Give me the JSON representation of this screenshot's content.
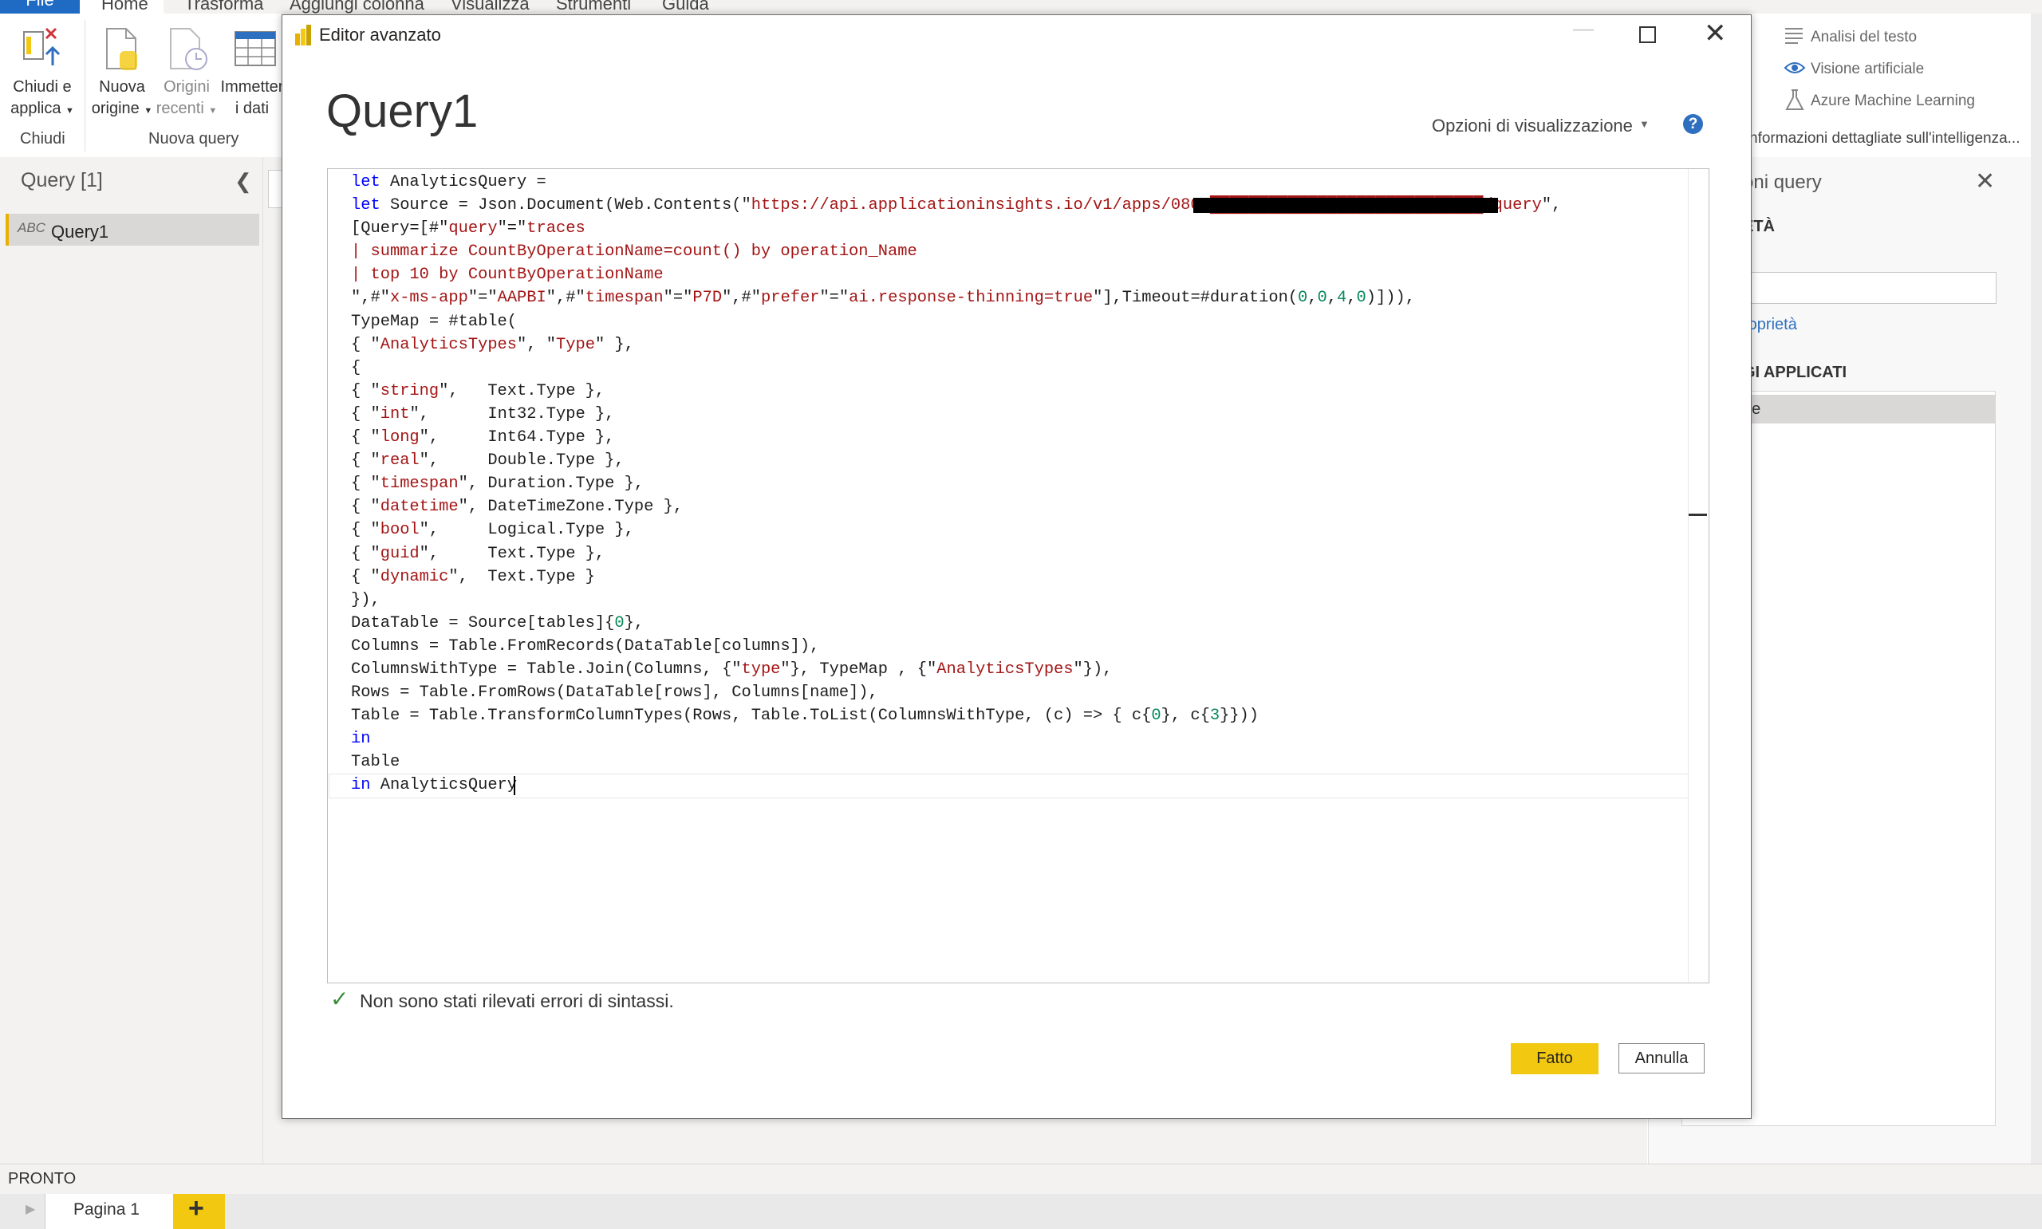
{
  "menu": {
    "tabs": [
      "File",
      "Home",
      "Trasforma",
      "Aggiungi colonna",
      "Visualizza",
      "Strumenti",
      "Guida"
    ]
  },
  "ribbon": {
    "close_apply": [
      "Chiudi e",
      "applica"
    ],
    "new_source": [
      "Nuova",
      "origine"
    ],
    "recent_sources": [
      "Origini",
      "recenti"
    ],
    "enter_data": [
      "Immetter",
      "i dati"
    ],
    "group_close": "Chiudi",
    "group_new_query": "Nuova query",
    "ai": {
      "text_analytics": "Analisi del testo",
      "vision": "Visione artificiale",
      "azure_ml": "Azure Machine Learning",
      "insights": "nformazioni dettagliate sull'intelligenza..."
    }
  },
  "left_pane": {
    "title": "Query [1]",
    "item": "Query1",
    "item_icon": "ABC"
  },
  "right_pane": {
    "title": "oni query",
    "properties": "ETÀ",
    "all_properties": "roprietà",
    "applied_steps": "GI APPLICATI",
    "step": "ne"
  },
  "status": "PRONTO",
  "pages": {
    "tab": "Pagina 1",
    "add": "+"
  },
  "dialog": {
    "title": "Editor avanzato",
    "query_name": "Query1",
    "view_options": "Opzioni di visualizzazione",
    "syntax_message": "Non sono stati rilevati errori di sintassi.",
    "done": "Fatto",
    "cancel": "Annulla",
    "code": [
      "let AnalyticsQuery =",
      "let Source = Json.Document(Web.Contents(\"https://api.applicationinsights.io/v1/apps/080a████████████████████████████/query\",",
      "[Query=[#\"query\"=\"traces",
      "| summarize CountByOperationName=count() by operation_Name",
      "| top 10 by CountByOperationName",
      "\",#\"x-ms-app\"=\"AAPBI\",#\"timespan\"=\"P7D\",#\"prefer\"=\"ai.response-thinning=true\"],Timeout=#duration(0,0,4,0)])),",
      "TypeMap = #table(",
      "{ \"AnalyticsTypes\", \"Type\" },",
      "{",
      "{ \"string\",   Text.Type },",
      "{ \"int\",      Int32.Type },",
      "{ \"long\",     Int64.Type },",
      "{ \"real\",     Double.Type },",
      "{ \"timespan\", Duration.Type },",
      "{ \"datetime\", DateTimeZone.Type },",
      "{ \"bool\",     Logical.Type },",
      "{ \"guid\",     Text.Type },",
      "{ \"dynamic\",  Text.Type }",
      "}),",
      "DataTable = Source[tables]{0},",
      "Columns = Table.FromRecords(DataTable[columns]),",
      "ColumnsWithType = Table.Join(Columns, {\"type\"}, TypeMap , {\"AnalyticsTypes\"}),",
      "Rows = Table.FromRows(DataTable[rows], Columns[name]),",
      "Table = Table.TransformColumnTypes(Rows, Table.ToList(ColumnsWithType, (c) => { c{0}, c{3}}))",
      "in",
      "Table",
      "in AnalyticsQuery"
    ]
  },
  "colors": {
    "accent_yellow": "#f2c811",
    "file_blue": "#1f6bc4",
    "keyword": "#0000ff",
    "string": "#a31515",
    "number": "#09885a"
  }
}
